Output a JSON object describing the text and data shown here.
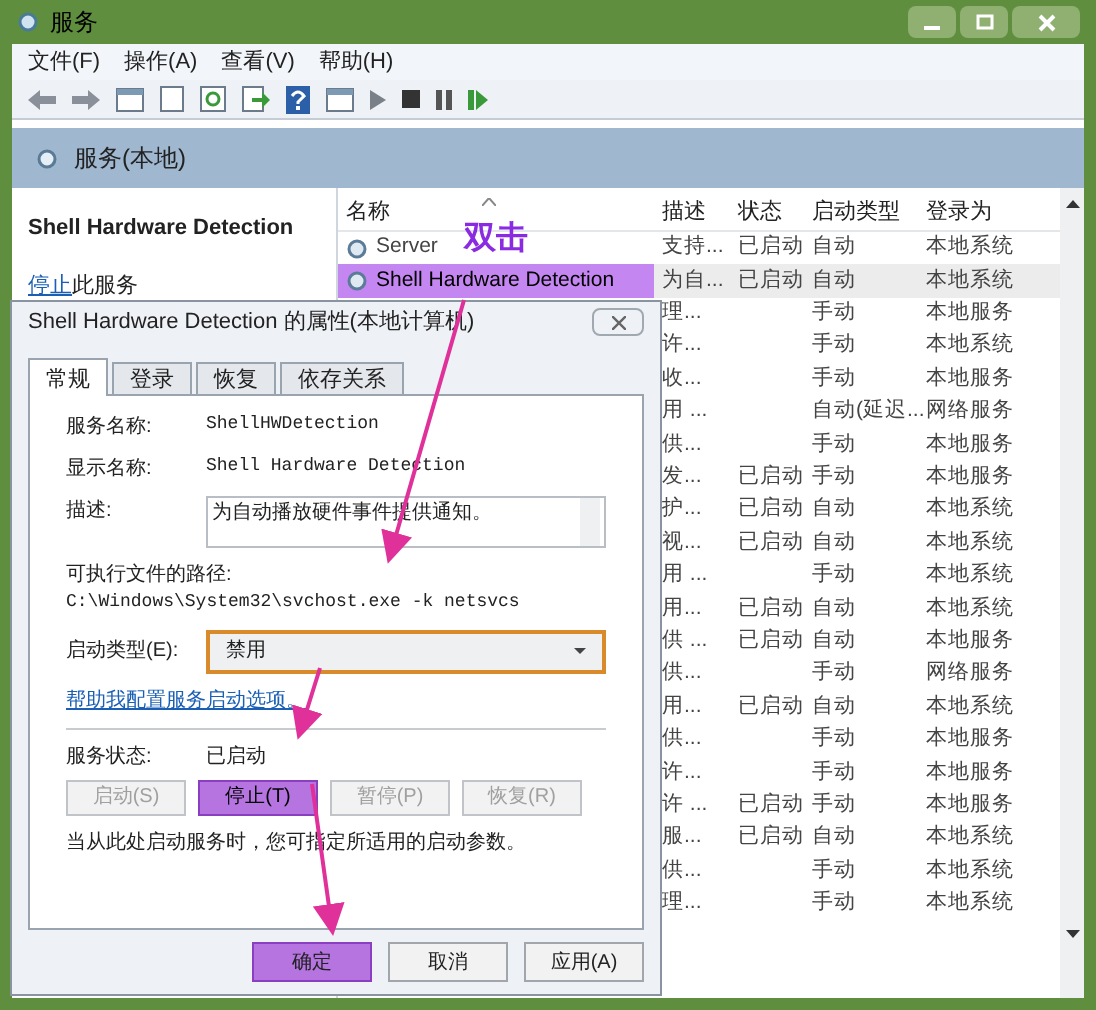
{
  "window": {
    "title": "服务"
  },
  "menu": [
    "文件(F)",
    "操作(A)",
    "查看(V)",
    "帮助(H)"
  ],
  "header": {
    "title": "服务(本地)"
  },
  "detail_panel": {
    "title": "Shell Hardware Detection",
    "action_link": "停止",
    "action_text": "此服务"
  },
  "table": {
    "columns": [
      {
        "label": "名称",
        "sorted": true
      },
      {
        "label": "描述",
        "sorted": false
      },
      {
        "label": "状态",
        "sorted": false
      },
      {
        "label": "启动类型",
        "sorted": false
      },
      {
        "label": "登录为",
        "sorted": false
      }
    ],
    "rows": [
      {
        "name": "Server",
        "description": "支持...",
        "status": "已启动",
        "startup_type": "自动",
        "log_on_as": "本地系统",
        "selected": false
      },
      {
        "name": "Shell Hardware Detection",
        "description": "为自...",
        "status": "已启动",
        "startup_type": "自动",
        "log_on_as": "本地系统",
        "selected": true
      },
      {
        "description": "理...",
        "startup_type": "手动",
        "log_on_as": "本地服务",
        "selected": false
      },
      {
        "description": "许...",
        "startup_type": "手动",
        "log_on_as": "本地系统",
        "selected": false
      },
      {
        "description": "收...",
        "startup_type": "手动",
        "log_on_as": "本地服务",
        "selected": false
      },
      {
        "description": "用 ...",
        "startup_type": "自动(延迟...",
        "log_on_as": "网络服务",
        "selected": false
      },
      {
        "description": "供...",
        "startup_type": "手动",
        "log_on_as": "本地服务",
        "selected": false
      },
      {
        "description": "发...",
        "status": "已启动",
        "startup_type": "手动",
        "log_on_as": "本地服务",
        "selected": false
      },
      {
        "description": "护...",
        "status": "已启动",
        "startup_type": "自动",
        "log_on_as": "本地系统",
        "selected": false
      },
      {
        "description": "视...",
        "status": "已启动",
        "startup_type": "自动",
        "log_on_as": "本地系统",
        "selected": false
      },
      {
        "description": "用 ...",
        "startup_type": "手动",
        "log_on_as": "本地系统",
        "selected": false
      },
      {
        "description": "用...",
        "status": "已启动",
        "startup_type": "自动",
        "log_on_as": "本地系统",
        "selected": false
      },
      {
        "description": "供 ...",
        "status": "已启动",
        "startup_type": "自动",
        "log_on_as": "本地服务",
        "selected": false
      },
      {
        "description": "供...",
        "startup_type": "手动",
        "log_on_as": "网络服务",
        "selected": false
      },
      {
        "description": "用...",
        "status": "已启动",
        "startup_type": "自动",
        "log_on_as": "本地系统",
        "selected": false
      },
      {
        "description": "供...",
        "startup_type": "手动",
        "log_on_as": "本地服务",
        "selected": false
      },
      {
        "description": "许...",
        "startup_type": "手动",
        "log_on_as": "本地服务",
        "selected": false
      },
      {
        "description": "许 ...",
        "status": "已启动",
        "startup_type": "手动",
        "log_on_as": "本地服务",
        "selected": false
      },
      {
        "description": "服...",
        "status": "已启动",
        "startup_type": "自动",
        "log_on_as": "本地系统",
        "selected": false
      },
      {
        "description": "供...",
        "startup_type": "手动",
        "log_on_as": "本地系统",
        "selected": false
      },
      {
        "description": "理...",
        "startup_type": "手动",
        "log_on_as": "本地系统",
        "selected": false
      }
    ]
  },
  "annotation": {
    "label": "双击"
  },
  "dialog": {
    "title": "Shell Hardware Detection 的属性(本地计算机)",
    "tabs": [
      {
        "label": "常规",
        "selected": true
      },
      {
        "label": "登录",
        "selected": false
      },
      {
        "label": "恢复",
        "selected": false
      },
      {
        "label": "依存关系",
        "selected": false
      }
    ],
    "fields": [
      {
        "label": "服务名称:",
        "value": "ShellHWDetection",
        "kind": "text"
      },
      {
        "label": "显示名称:",
        "value": "Shell Hardware Detection",
        "kind": "text"
      },
      {
        "label": "描述:",
        "value": "为自动播放硬件事件提供通知。",
        "kind": "textarea"
      }
    ],
    "path_label": "可执行文件的路径:",
    "path": "C:\\Windows\\System32\\svchost.exe -k netsvcs",
    "startup": {
      "label": "启动类型(E):",
      "value": "禁用",
      "highlighted": true
    },
    "help_link": "帮助我配置服务启动选项。",
    "status": {
      "label": "服务状态:",
      "value": "已启动"
    },
    "service_buttons": [
      {
        "label": "启动(S)",
        "disabled": true,
        "highlighted": false
      },
      {
        "label": "停止(T)",
        "disabled": false,
        "highlighted": true
      },
      {
        "label": "暂停(P)",
        "disabled": true,
        "highlighted": false
      },
      {
        "label": "恢复(R)",
        "disabled": true,
        "highlighted": false
      }
    ],
    "hint": "当从此处启动服务时，您可指定所适用的启动参数。",
    "buttons": [
      {
        "label": "确定",
        "highlighted": true
      },
      {
        "label": "取消",
        "highlighted": false
      },
      {
        "label": "应用(A)",
        "highlighted": false
      }
    ]
  }
}
